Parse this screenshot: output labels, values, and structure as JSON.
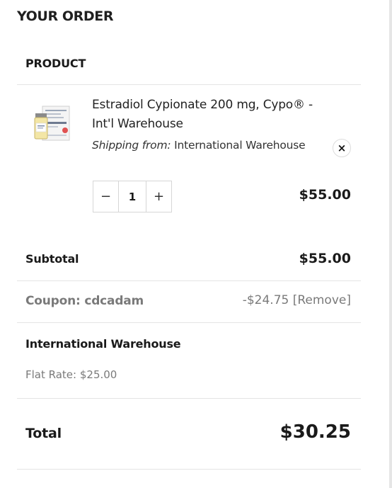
{
  "order_title": "YOUR ORDER",
  "table": {
    "product_header": "PRODUCT"
  },
  "item": {
    "name": "Estradiol Cypionate 200 mg, Cypo® - Int'l Warehouse",
    "shipping_label": "Shipping from:",
    "shipping_value": "International Warehouse",
    "remove_icon": "×",
    "quantity": "1",
    "decrement": "−",
    "increment": "+",
    "price": "$55.00"
  },
  "subtotal": {
    "label": "Subtotal",
    "value": "$55.00"
  },
  "coupon": {
    "label": "Coupon: cdcadam",
    "value": "-$24.75",
    "remove_label": "[Remove]"
  },
  "shipping": {
    "title": "International Warehouse",
    "rate": "Flat Rate: $25.00"
  },
  "total": {
    "label": "Total",
    "value": "$30.25"
  }
}
